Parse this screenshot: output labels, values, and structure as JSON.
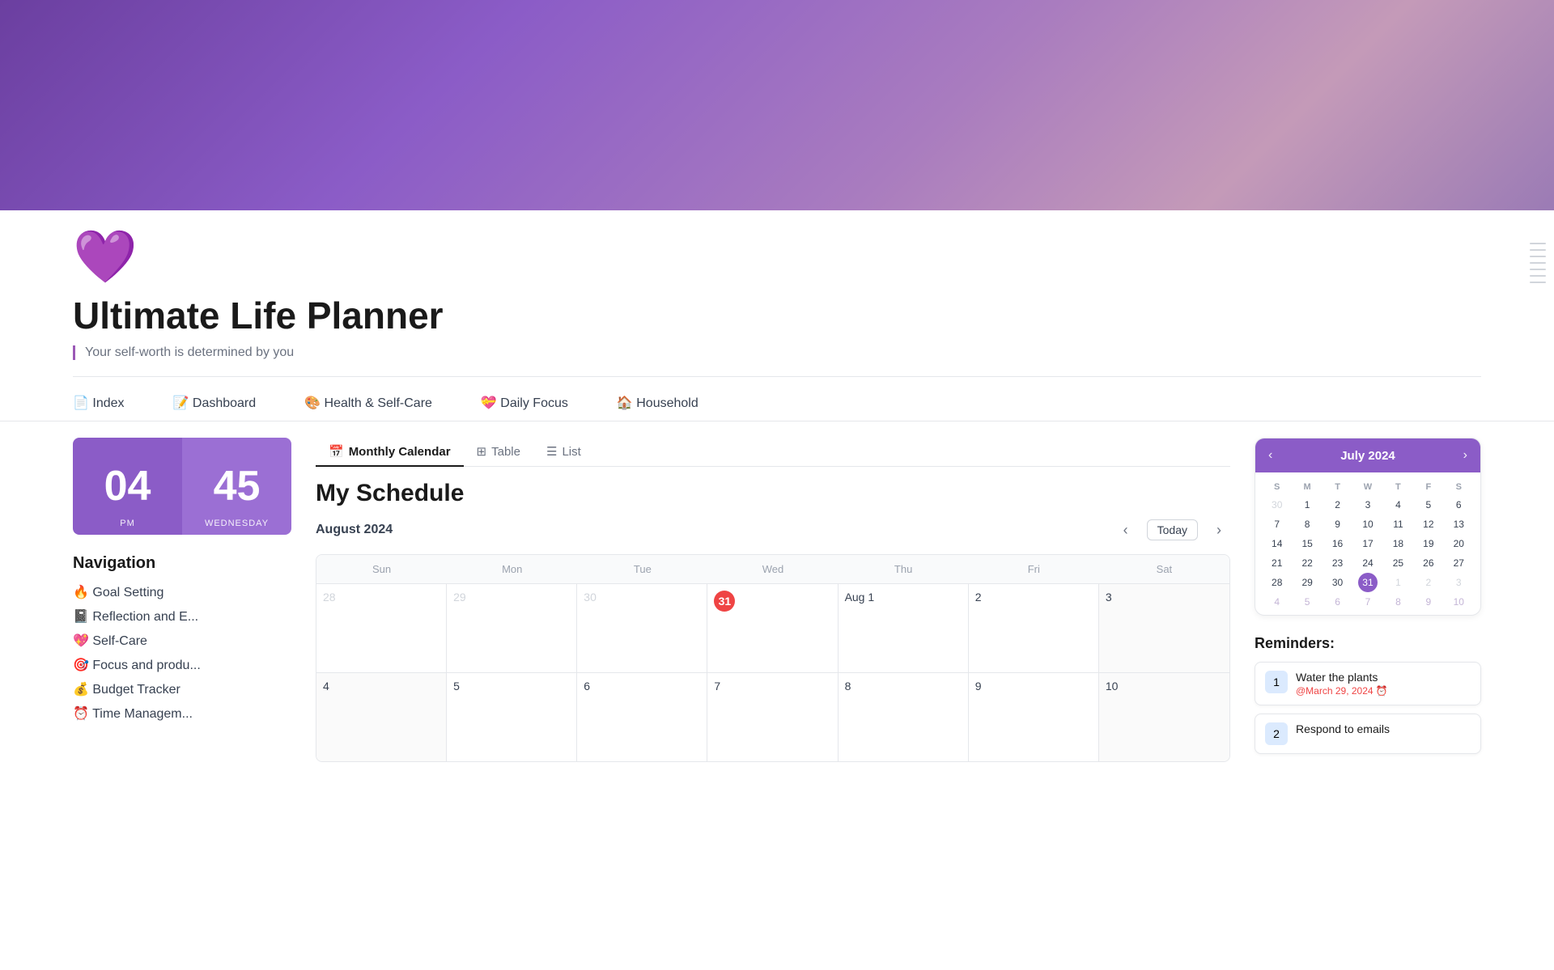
{
  "page": {
    "title": "Ultimate Life Planner",
    "subtitle": "Your self-worth is determined by you",
    "heart_emoji": "💜"
  },
  "top_nav": {
    "items": [
      {
        "label": "📄 Index"
      },
      {
        "label": "📝 Dashboard"
      },
      {
        "label": "🎨 Health & Self-Care"
      },
      {
        "label": "💝 Daily Focus"
      },
      {
        "label": "🏠 Household"
      }
    ]
  },
  "clock": {
    "hours": "04",
    "minutes": "45",
    "period": "PM",
    "day": "WEDNESDAY"
  },
  "navigation": {
    "title": "Navigation",
    "items": [
      {
        "label": "🔥 Goal Setting"
      },
      {
        "label": "📓 Reflection and E..."
      },
      {
        "label": "💖 Self-Care"
      },
      {
        "label": "🎯 Focus and produ..."
      },
      {
        "label": "💰 Budget Tracker"
      },
      {
        "label": "⏰ Time Managem..."
      }
    ]
  },
  "schedule": {
    "title": "My Schedule",
    "month_label": "August 2024",
    "tabs": [
      {
        "label": "Monthly Calendar",
        "icon": "📅"
      },
      {
        "label": "Table",
        "icon": "⊞"
      },
      {
        "label": "List",
        "icon": "☰"
      }
    ],
    "active_tab": 0,
    "today_label": "Today",
    "day_headers": [
      "Sun",
      "Mon",
      "Tue",
      "Wed",
      "Thu",
      "Fri",
      "Sat"
    ],
    "rows": [
      [
        {
          "date": "28",
          "other": true
        },
        {
          "date": "29",
          "other": true
        },
        {
          "date": "30",
          "other": true
        },
        {
          "date": "31",
          "other": true,
          "today": true
        },
        {
          "date": "Aug 1",
          "other": false
        },
        {
          "date": "2",
          "other": false
        },
        {
          "date": "3",
          "other": false
        }
      ],
      [
        {
          "date": "4",
          "other": false
        },
        {
          "date": "5",
          "other": false
        },
        {
          "date": "6",
          "other": false
        },
        {
          "date": "7",
          "other": false
        },
        {
          "date": "8",
          "other": false
        },
        {
          "date": "9",
          "other": false
        },
        {
          "date": "10",
          "other": false
        }
      ]
    ]
  },
  "mini_calendar": {
    "title": "July 2024",
    "day_headers": [
      "S",
      "M",
      "T",
      "W",
      "T",
      "F",
      "S"
    ],
    "weeks": [
      [
        {
          "date": "30",
          "other": true
        },
        {
          "date": "1",
          "other": false
        },
        {
          "date": "2",
          "other": false
        },
        {
          "date": "3",
          "other": false
        },
        {
          "date": "4",
          "other": false
        },
        {
          "date": "5",
          "other": false
        },
        {
          "date": "6",
          "other": false
        }
      ],
      [
        {
          "date": "7",
          "other": false
        },
        {
          "date": "8",
          "other": false
        },
        {
          "date": "9",
          "other": false
        },
        {
          "date": "10",
          "other": false
        },
        {
          "date": "11",
          "other": false
        },
        {
          "date": "12",
          "other": false
        },
        {
          "date": "13",
          "other": false
        }
      ],
      [
        {
          "date": "14",
          "other": false
        },
        {
          "date": "15",
          "other": false
        },
        {
          "date": "16",
          "other": false
        },
        {
          "date": "17",
          "other": false
        },
        {
          "date": "18",
          "other": false
        },
        {
          "date": "19",
          "other": false
        },
        {
          "date": "20",
          "other": false
        }
      ],
      [
        {
          "date": "21",
          "other": false
        },
        {
          "date": "22",
          "other": false
        },
        {
          "date": "23",
          "other": false
        },
        {
          "date": "24",
          "other": false
        },
        {
          "date": "25",
          "other": false
        },
        {
          "date": "26",
          "other": false
        },
        {
          "date": "27",
          "other": false
        }
      ],
      [
        {
          "date": "28",
          "other": false
        },
        {
          "date": "29",
          "other": false
        },
        {
          "date": "30",
          "other": false
        },
        {
          "date": "31",
          "today": true,
          "other": false
        },
        {
          "date": "1",
          "other": true
        },
        {
          "date": "2",
          "other": true
        },
        {
          "date": "3",
          "other": true
        }
      ],
      [
        {
          "date": "4",
          "other": true,
          "faded": true
        },
        {
          "date": "5",
          "other": true,
          "faded": true
        },
        {
          "date": "6",
          "other": true,
          "faded": true
        },
        {
          "date": "7",
          "other": true,
          "faded": true
        },
        {
          "date": "8",
          "other": true,
          "faded": true
        },
        {
          "date": "9",
          "other": true,
          "faded": true
        },
        {
          "date": "10",
          "other": true,
          "faded": true
        }
      ]
    ]
  },
  "reminders": {
    "title": "Reminders:",
    "items": [
      {
        "icon": "1",
        "text": "Water the plants",
        "date": "@March 29, 2024 ⏰"
      },
      {
        "icon": "2",
        "text": "Respond to emails",
        "date": ""
      }
    ]
  }
}
